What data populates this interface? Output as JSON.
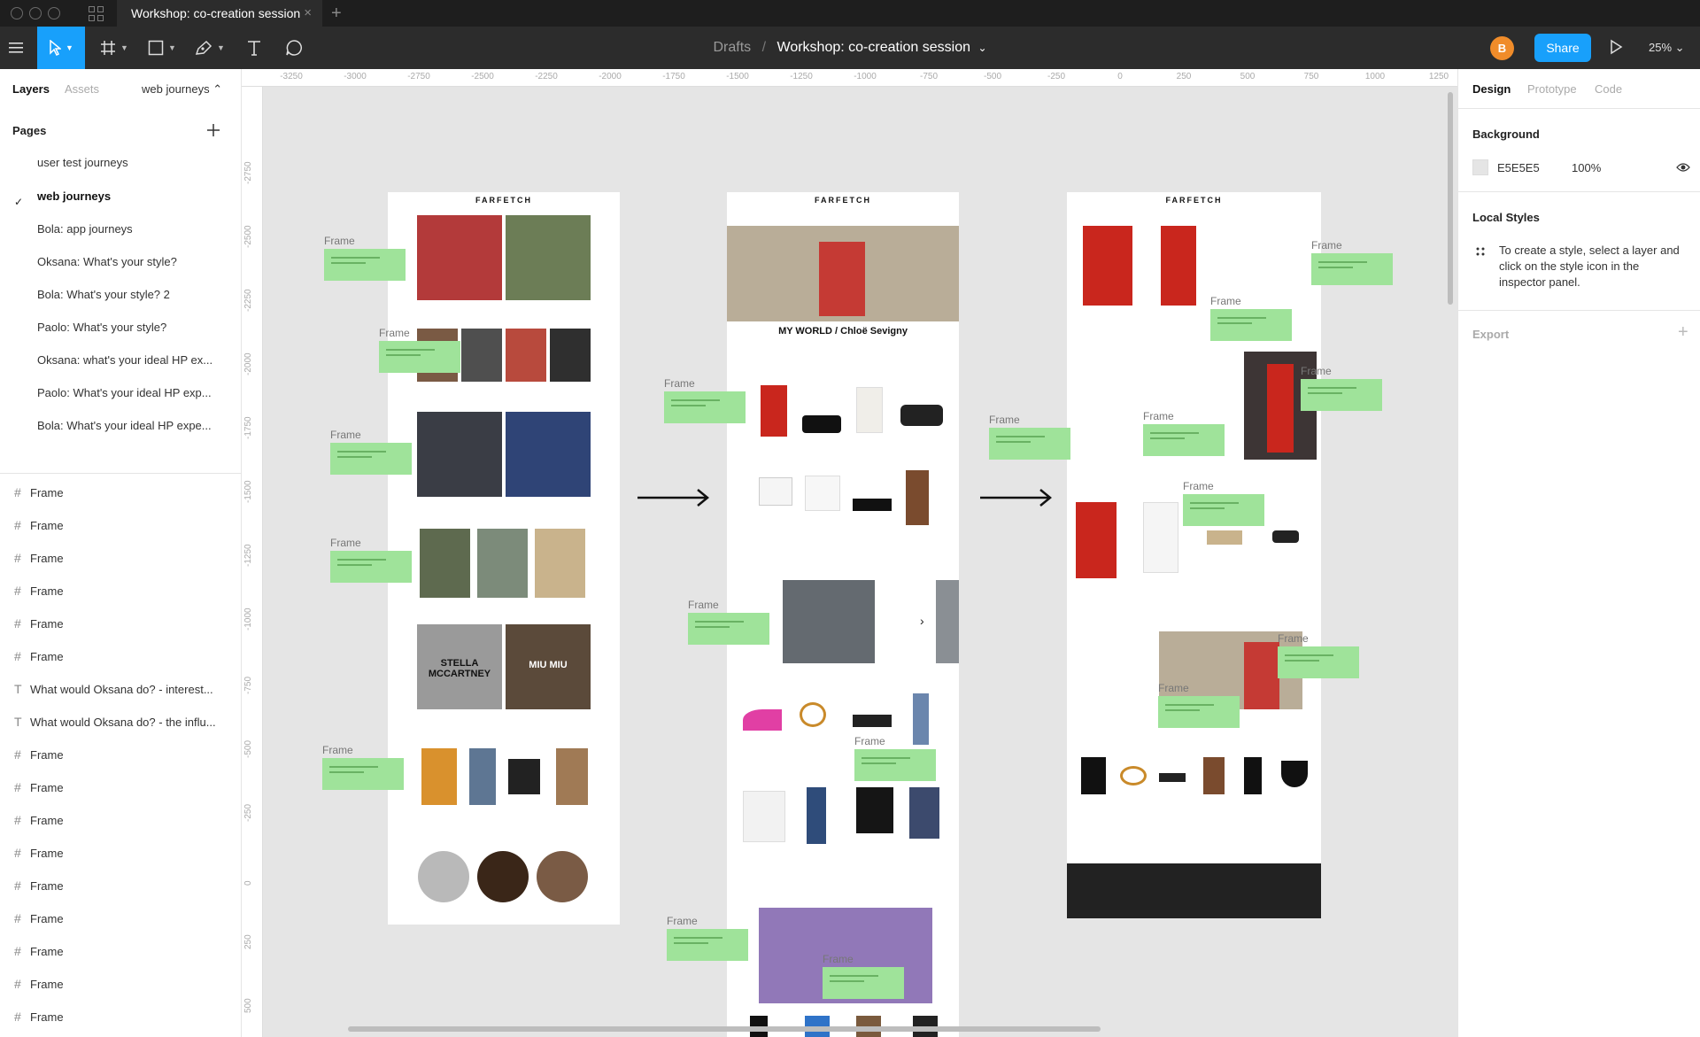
{
  "tab": {
    "title": "Workshop: co-creation session",
    "close": "×",
    "new": "+"
  },
  "toolbar": {
    "breadcrumb_root": "Drafts",
    "breadcrumb_sep": "/",
    "file_name": "Workshop: co-creation session",
    "file_caret": "⌄",
    "avatar_initial": "B",
    "share_label": "Share",
    "zoom_label": "25% ⌄"
  },
  "left_panel": {
    "tabs": [
      "Layers",
      "Assets",
      "web journeys ⌃"
    ],
    "pages_title": "Pages",
    "pages": [
      "user test journeys",
      "web journeys",
      "Bola: app journeys",
      "Oksana: What's your style?",
      "Bola: What's your style? 2",
      "Paolo: What's your style?",
      "Oksana: what's your ideal HP ex...",
      "Paolo: What's your ideal HP exp...",
      "Bola: What's your ideal HP expe..."
    ],
    "current_page_mark": "✓",
    "layers": [
      {
        "icon": "#",
        "label": "Frame"
      },
      {
        "icon": "#",
        "label": "Frame"
      },
      {
        "icon": "#",
        "label": "Frame"
      },
      {
        "icon": "#",
        "label": "Frame"
      },
      {
        "icon": "#",
        "label": "Frame"
      },
      {
        "icon": "#",
        "label": "Frame"
      },
      {
        "icon": "T",
        "label": "What would Oksana do? - interest..."
      },
      {
        "icon": "T",
        "label": "What would Oksana do? - the influ..."
      },
      {
        "icon": "#",
        "label": "Frame"
      },
      {
        "icon": "#",
        "label": "Frame"
      },
      {
        "icon": "#",
        "label": "Frame"
      },
      {
        "icon": "#",
        "label": "Frame"
      },
      {
        "icon": "#",
        "label": "Frame"
      },
      {
        "icon": "#",
        "label": "Frame"
      },
      {
        "icon": "#",
        "label": "Frame"
      },
      {
        "icon": "#",
        "label": "Frame"
      },
      {
        "icon": "#",
        "label": "Frame"
      }
    ]
  },
  "canvas": {
    "ruler_x": [
      "-3250",
      "-3000",
      "-2750",
      "-2500",
      "-2250",
      "-2000",
      "-1750",
      "-1500",
      "-1250",
      "-1000",
      "-750",
      "-500",
      "-250",
      "0",
      "250",
      "500",
      "750",
      "1000",
      "1250"
    ],
    "ruler_y": [
      "-2750",
      "-2500",
      "-2250",
      "-2000",
      "-1750",
      "-1500",
      "-1250",
      "-1000",
      "-750",
      "-500",
      "-250",
      "0",
      "250",
      "500"
    ],
    "frame_label": "Frame",
    "brand": "FARFETCH",
    "art1_banner_1": "STELLA MCCARTNEY",
    "art1_banner_2": "MIU MIU",
    "art2_title": "MY WORLD / Chloë Sevigny",
    "help": "?"
  },
  "right_panel": {
    "tabs": [
      "Design",
      "Prototype",
      "Code"
    ],
    "background_title": "Background",
    "background_hex": "E5E5E5",
    "background_opacity": "100%",
    "local_styles_title": "Local Styles",
    "local_styles_text": "To create a style, select a layer and click on the style icon in the inspector panel.",
    "export_title": "Export",
    "export_add": "+"
  }
}
